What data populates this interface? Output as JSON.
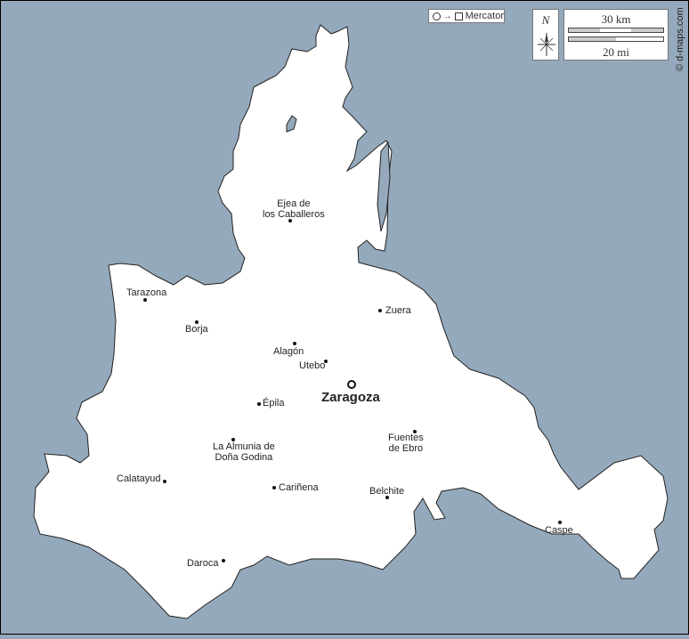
{
  "map": {
    "projection_label": "Mercator",
    "north_label": "N",
    "scale_km": "30 km",
    "scale_mi": "20 mi",
    "credit": "© d-maps.com",
    "colors": {
      "sea": "#94a9bb",
      "land": "#ffffff",
      "border": "#222222"
    },
    "capital": "Zaragoza",
    "cities": {
      "ejea": "Ejea de\nlos Caballeros",
      "tarazona": "Tarazona",
      "borja": "Borja",
      "zuera": "Zuera",
      "alagon": "Alagón",
      "utebo": "Utebo",
      "epila": "Épila",
      "almunia": "La Almunia de\nDoña Godina",
      "fuentes": "Fuentes\nde Ebro",
      "calatayud": "Calatayud",
      "carinena": "Cariñena",
      "belchite": "Belchite",
      "caspe": "Caspe",
      "daroca": "Daroca"
    }
  }
}
